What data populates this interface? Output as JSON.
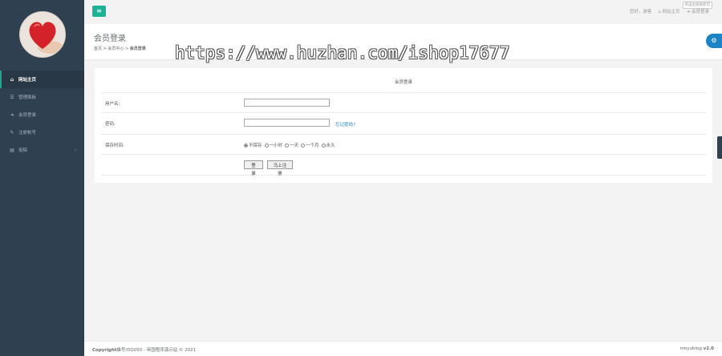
{
  "topbar": {
    "menu_icon": "bars-icon",
    "greeting": "您好，游客",
    "links": [
      {
        "icon": "home-icon",
        "label": "网站主页"
      },
      {
        "icon": "sign-in-icon",
        "label": "会员登录"
      }
    ],
    "tooltip": "单击此链接即可"
  },
  "sidebar": {
    "items": [
      {
        "icon": "home-icon",
        "label": "网站主页",
        "active": true
      },
      {
        "icon": "list-icon",
        "label": "管理面板"
      },
      {
        "icon": "sign-in-icon",
        "label": "会员登录"
      },
      {
        "icon": "register-icon",
        "label": "注册帐号"
      },
      {
        "icon": "file-icon",
        "label": "投稿",
        "has_arrow": true
      }
    ]
  },
  "heading": {
    "title": "会员登录",
    "breadcrumb": [
      "首页",
      "会员中心",
      "会员登录"
    ]
  },
  "watermark": "https://www.huzhan.com/ishop17677",
  "form": {
    "title": "会员登录",
    "username_label": "用户名:",
    "password_label": "密码:",
    "forgot_link": "忘记密码?",
    "keep_label": "保存时间:",
    "keep_options": [
      "不保存",
      "一小时",
      "一天",
      "一个月",
      "永久"
    ],
    "keep_selected": "不保存",
    "login_button": "登 录",
    "register_button": "马上注册"
  },
  "footer": {
    "copyright": "Copyright",
    "copyright_rest": "蜂号/DG050 - 帝国程序演示站 © 2021",
    "brand": "moyublog",
    "version": "v2.0"
  },
  "colors": {
    "sidebar": "#2f4050",
    "accent": "#1ab394",
    "link": "#1c84c6"
  }
}
